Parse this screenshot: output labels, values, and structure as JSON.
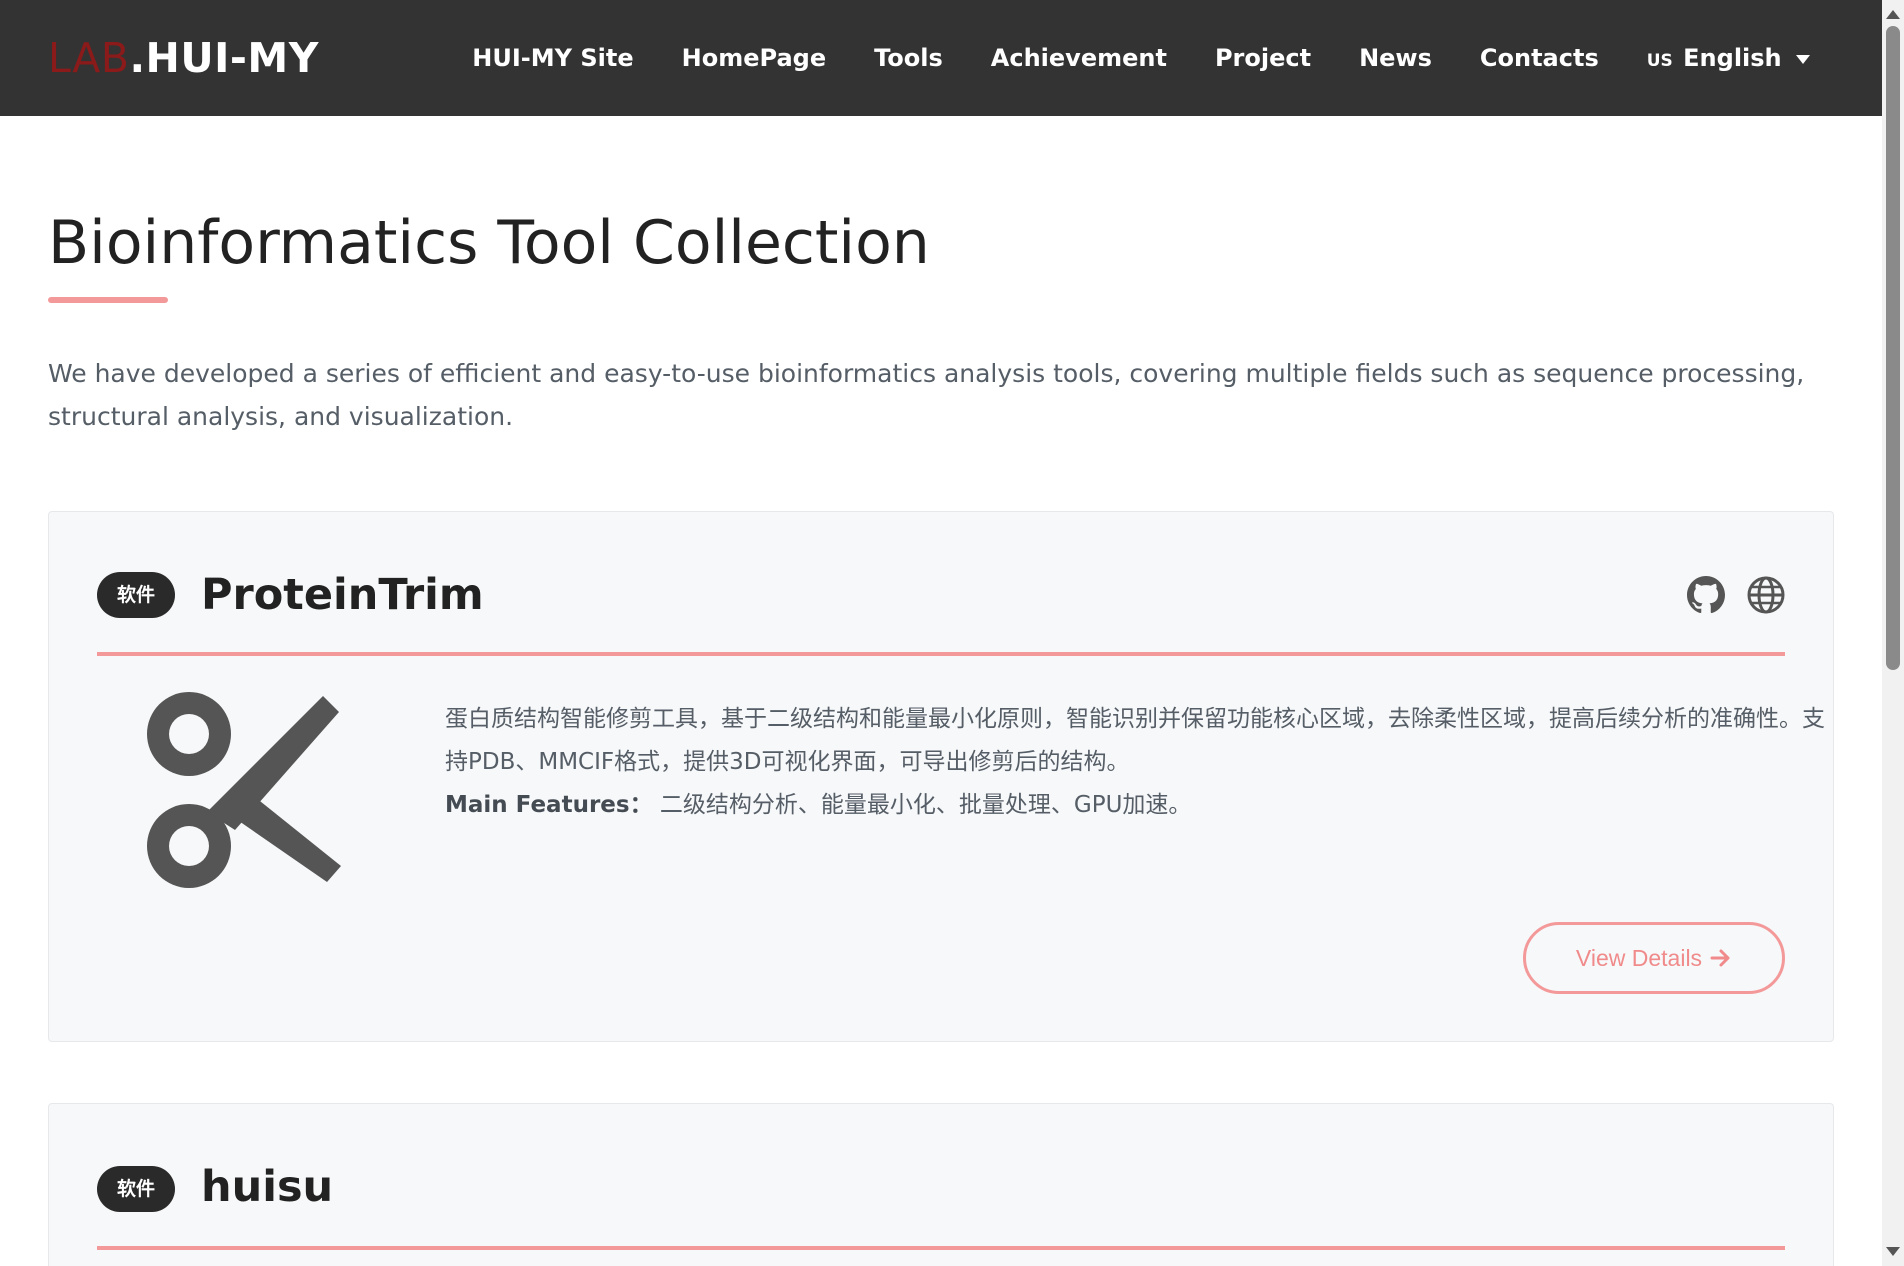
{
  "brand": {
    "prefix": "LAB",
    "suffix": ".HUI-MY"
  },
  "nav": {
    "items": [
      "HUI-MY Site",
      "HomePage",
      "Tools",
      "Achievement",
      "Project",
      "News",
      "Contacts"
    ],
    "language": {
      "flag": "US",
      "label": "English",
      "icon": "chevron-down-icon"
    }
  },
  "page": {
    "title": "Bioinformatics Tool Collection",
    "intro": "We have developed a series of efficient and easy-to-use bioinformatics analysis tools, covering multiple fields such as sequence processing, structural analysis, and visualization."
  },
  "tools": [
    {
      "badge": "软件",
      "name": "ProteinTrim",
      "icons": [
        "github-icon",
        "globe-icon"
      ],
      "art_icon": "scissors-icon",
      "description": "蛋白质结构智能修剪工具，基于二级结构和能量最小化原则，智能识别并保留功能核心区域，去除柔性区域，提高后续分析的准确性。支持PDB、MMCIF格式，提供3D可视化界面，可导出修剪后的结构。",
      "features_label": "Main Features：",
      "features": "二级结构分析、能量最小化、批量处理、GPU加速。",
      "button": "View Details",
      "button_icon": "arrow-right-icon"
    },
    {
      "badge": "软件",
      "name": "huisu"
    }
  ],
  "colors": {
    "navbar": "#333333",
    "accent": "#f4999a",
    "brand_accent": "#8b1a1a",
    "card_bg": "#f7f8f9",
    "badge_bg": "#2a2a2a"
  }
}
